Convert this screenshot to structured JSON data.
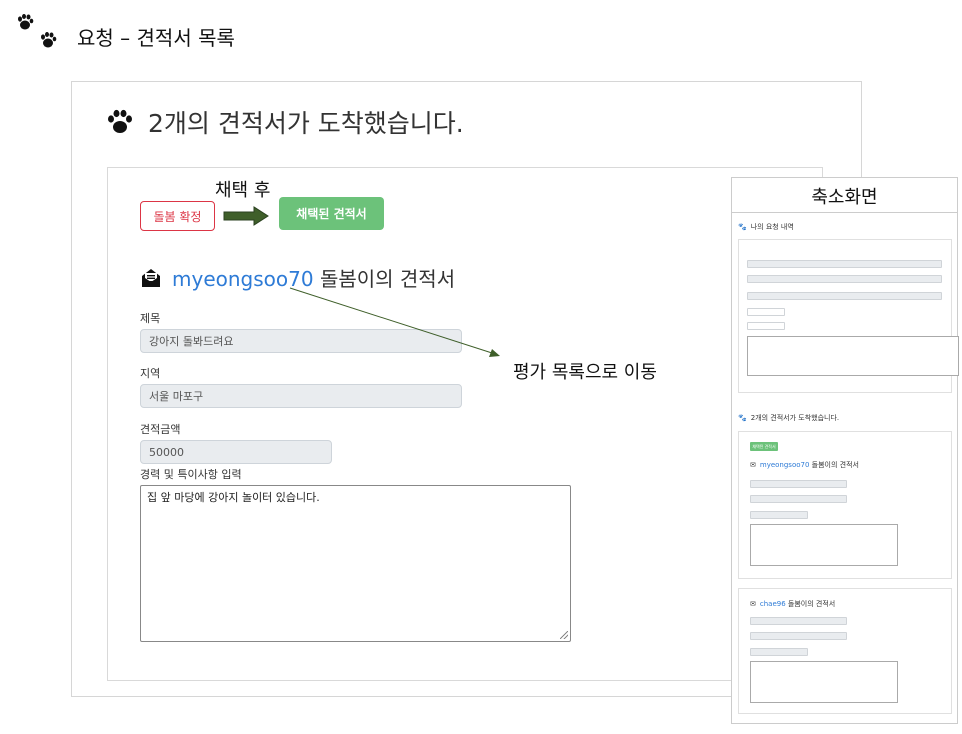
{
  "header": {
    "title": "요청 – 견적서 목록",
    "icon": "paws-icon"
  },
  "main": {
    "heading": "2개의 견적서가 도착했습니다.",
    "card": {
      "confirm_button": "돌봄 확정",
      "after_select_label": "채택 후",
      "selected_button": "채택된 견적서",
      "quote_user": "myeongsoo70",
      "quote_suffix": "돌봄이의 견적서",
      "fields": {
        "title_label": "제목",
        "title_value": "강아지 돌봐드려요",
        "region_label": "지역",
        "region_value": "서울 마포구",
        "price_label": "견적금액",
        "price_value": "50000",
        "notes_label": "경력 및 특이사항 입력",
        "notes_value": "집 앞 마당에 강아지 놀이터 있습니다."
      }
    },
    "annotation": "평가 목록으로 이동"
  },
  "thumbnail": {
    "title": "축소화면",
    "section1": {
      "heading": "나의 요청 내역"
    },
    "section2": {
      "heading": "2개의 견적서가 도착했습니다.",
      "button": "채택된 견적서",
      "user": "myeongsoo70",
      "suffix": "돌봄이의 견적서"
    },
    "section3": {
      "user": "chae96",
      "suffix": "돌봄이의 견적서"
    }
  },
  "colors": {
    "accent": "#2e7bd6",
    "success": "#6cc27a",
    "danger": "#dc3545",
    "arrow": "#3f5f2a"
  }
}
